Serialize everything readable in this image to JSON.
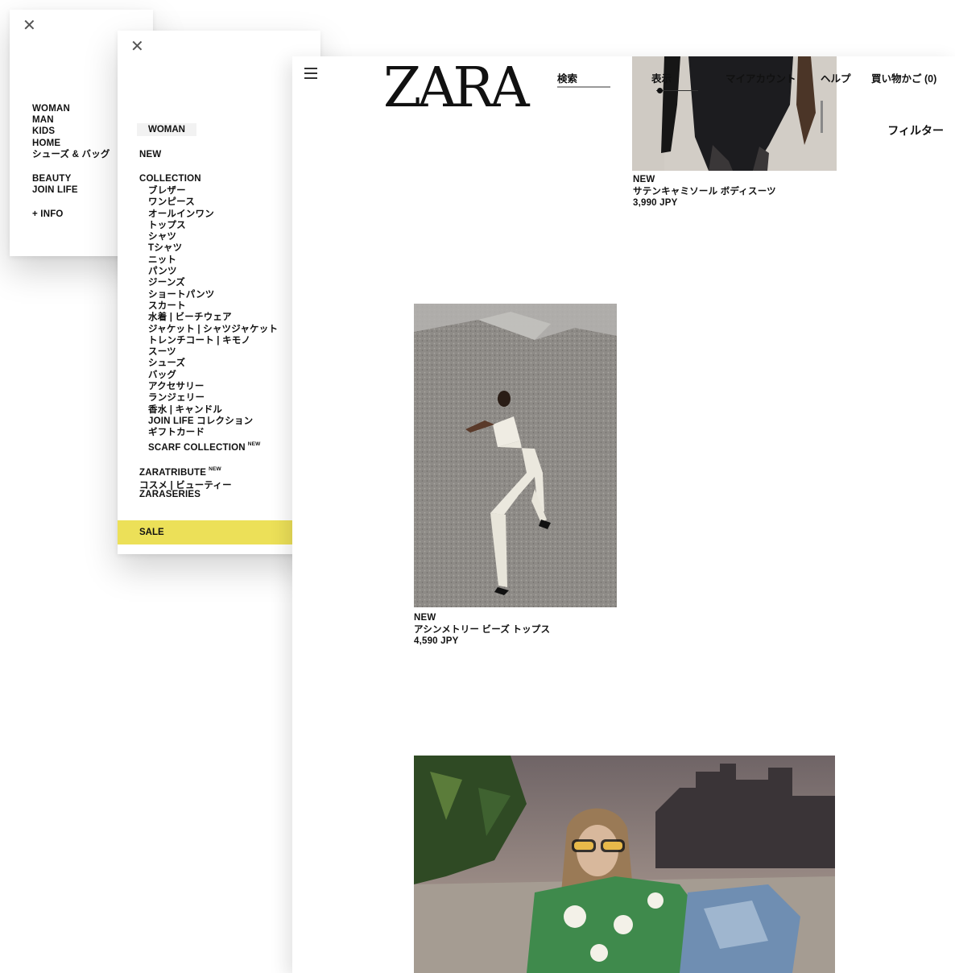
{
  "menu_level1": {
    "items": [
      "WOMAN",
      "MAN",
      "KIDS",
      "HOME",
      "シューズ & バッグ"
    ],
    "secondary": [
      "BEAUTY",
      "JOIN LIFE"
    ],
    "info": "+ INFO"
  },
  "menu_level2": {
    "tab": "WOMAN",
    "new": "NEW",
    "collection": "COLLECTION",
    "collection_items": [
      "ブレザー",
      "ワンピース",
      "オールインワン",
      "トップス",
      "シャツ",
      "Tシャツ",
      "ニット",
      "パンツ",
      "ジーンズ",
      "ショートパンツ",
      "スカート",
      "水着 | ビーチウェア",
      "ジャケット | シャツジャケット",
      "トレンチコート | キモノ",
      "スーツ",
      "シューズ",
      "バッグ",
      "アクセサリー",
      "ランジェリー",
      "香水 | キャンドル",
      "JOIN LIFE コレクション",
      "ギフトカード"
    ],
    "scarf": "SCARF COLLECTION",
    "new_badge": "NEW",
    "zaratribute": "ZARATRIBUTE",
    "cosme": "コスメ | ビューティー",
    "zaraseries": "ZARASERIES",
    "sale": "SALE",
    "sale_color": "#ece058"
  },
  "header": {
    "logo": "ZARA",
    "search": "検索",
    "view": "表示",
    "account": "マイアカウント",
    "help": "ヘルプ",
    "cart": "買い物かご (0)",
    "filter": "フィルター"
  },
  "products": [
    {
      "badge": "NEW",
      "name": "サテンキャミソール ボディスーツ",
      "price": "3,990 JPY"
    },
    {
      "badge": "NEW",
      "name": "アシンメトリー ビーズ トップス",
      "price": "4,590 JPY"
    }
  ]
}
